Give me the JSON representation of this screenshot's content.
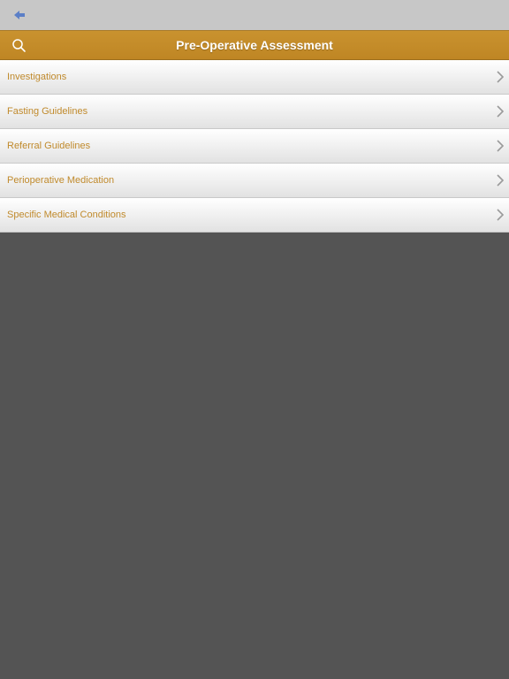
{
  "header": {
    "title": "Pre-Operative Assessment"
  },
  "icons": {
    "back": "arrow-left-icon",
    "search": "search-icon",
    "chevron": "chevron-right-icon"
  },
  "colors": {
    "top_bar": "#c7c7c7",
    "title_bar": "#c38a2a",
    "item_text": "#c08a2c",
    "back_arrow": "#5b7fc7",
    "background": "#545454"
  },
  "menu": {
    "items": [
      {
        "label": "Investigations"
      },
      {
        "label": "Fasting Guidelines"
      },
      {
        "label": "Referral Guidelines"
      },
      {
        "label": "Perioperative Medication"
      },
      {
        "label": "Specific Medical Conditions"
      }
    ]
  }
}
